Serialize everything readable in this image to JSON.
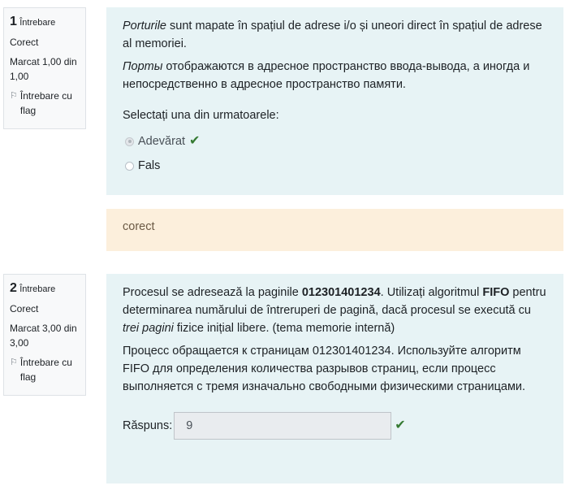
{
  "q1": {
    "number": "1",
    "word": "Întrebare",
    "state": "Corect",
    "mark": "Marcat 1,00 din 1,00",
    "flag_label": "Întrebare cu flag",
    "text_ro_italic": "Porturile",
    "text_ro_rest": " sunt mapate în spațiul de adrese i/o și uneori direct în spațiul de adrese al    memoriei.",
    "text_ru_italic": "Порты",
    "text_ru_rest": " отображаются в адресное пространство ввода-вывода, а иногда и непосредственно в адресное пространство памяти.",
    "prompt": "Selectați una din urmatoarele:",
    "options": [
      {
        "label": "Adevărat",
        "checked": true
      },
      {
        "label": "Fals",
        "checked": false
      }
    ],
    "feedback": "corect"
  },
  "q2": {
    "number": "2",
    "word": "Întrebare",
    "state": "Corect",
    "mark": "Marcat 3,00 din 3,00",
    "flag_label": "Întrebare cu flag",
    "p1_a": "Procesul se adresează la paginile ",
    "p1_b": "012301401234",
    "p1_c": ". Utilizați algoritmul ",
    "p1_d": "FIFO",
    "p1_e": " pentru determinarea numărului de întreruperi de pagină, dacă procesul se execută cu ",
    "p1_f": "trei pagini",
    "p1_g": " fizice inițial libere. (tema memorie internă)",
    "p2": "Процесс обращается к страницам 012301401234. Используйте алгоритм FIFO для определения количества разрывов страниц, если процесс выполняется с тремя изначально свободными физическими страницами.",
    "answer_label": "Răspuns:",
    "answer_value": "9"
  },
  "colors": {
    "formulation_bg": "#e7f3f5",
    "feedback_bg": "#fcefdc",
    "correct_green": "#357a32"
  }
}
